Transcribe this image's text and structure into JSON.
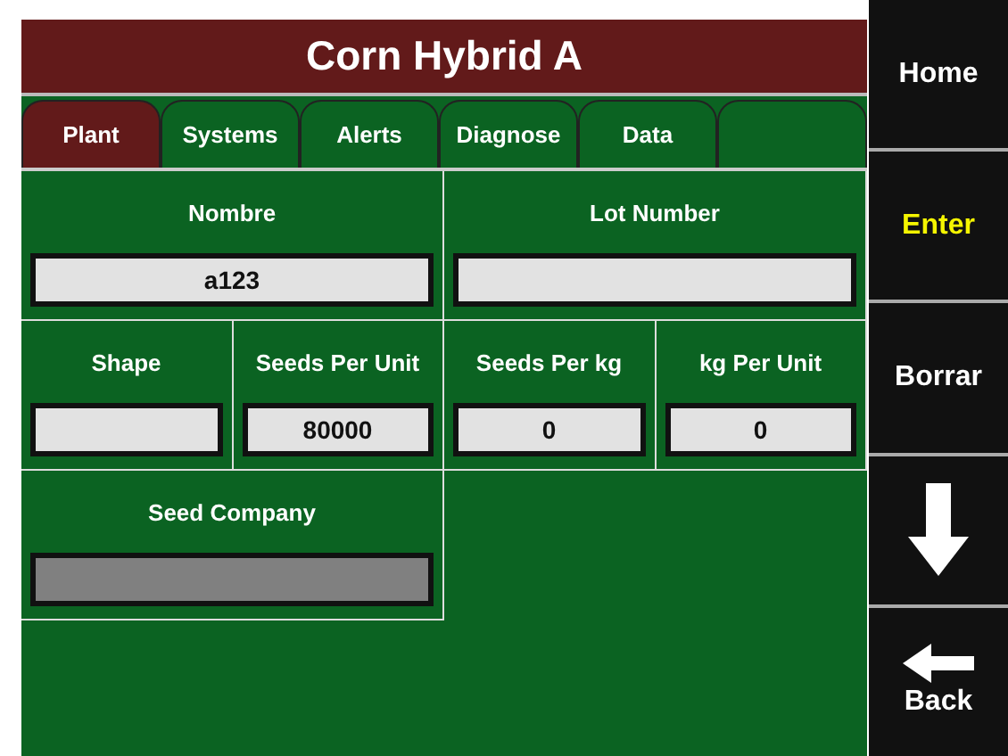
{
  "window": {
    "title": "Corn Hybrid A"
  },
  "tabs": [
    {
      "label": "Plant",
      "selected": true
    },
    {
      "label": "Systems",
      "selected": false
    },
    {
      "label": "Alerts",
      "selected": false
    },
    {
      "label": "Diagnose",
      "selected": false
    },
    {
      "label": "Data",
      "selected": false
    }
  ],
  "fields": [
    {
      "kind": "wide",
      "label": "Nombre",
      "value": "a123",
      "disabled": false
    },
    {
      "kind": "wide",
      "label": "Lot Number",
      "disabled": false
    },
    {
      "kind": "narrow",
      "label": "Shape",
      "disabled": false
    },
    {
      "kind": "narrow",
      "label": "Seeds Per Unit",
      "value": "80000",
      "disabled": false
    },
    {
      "kind": "narrow",
      "label": "Seeds Per kg",
      "value": "0",
      "disabled": false
    },
    {
      "kind": "narrow",
      "label": "kg Per Unit",
      "value": "0",
      "disabled": false
    },
    {
      "kind": "wide",
      "label": "Seed Company",
      "disabled": true
    }
  ],
  "sidebar": [
    {
      "kind": "text",
      "label": "Home",
      "highlighted": false
    },
    {
      "kind": "text",
      "label": "Enter",
      "highlighted": true
    },
    {
      "kind": "text",
      "label": "Borrar",
      "highlighted": false
    },
    {
      "kind": "down"
    },
    {
      "kind": "back",
      "label": "Back",
      "highlighted": false
    }
  ]
}
